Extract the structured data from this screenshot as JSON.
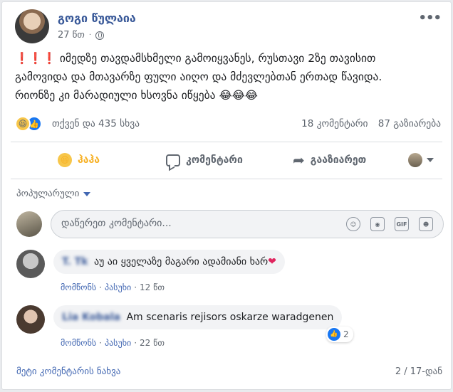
{
  "post": {
    "author": "გოგი წულაია",
    "time": "27 წთ",
    "exclamations": "❗❗❗",
    "text_line1": "იმედზე თავდამსხმელი გამოიყვანეს, რუსთავი 2ზე თავისით",
    "text_line2": "გამოვიდა და მთავარზე ფული აიღო და მძევლებთან ერთად წავიდა.",
    "text_line3": "რიონზე კი მარადიული ხსოვნა იწყება",
    "emojis": "😂😂😂"
  },
  "summary": {
    "reactions_text": "თქვენ და 435 სხვა",
    "comments_text": "18 კომენტარი",
    "shares_text": "87 გაზიარება"
  },
  "actions": {
    "haha_label": "ჰაჰა",
    "comment_label": "კომენტარი",
    "share_label": "გააზიარეთ"
  },
  "comments_section": {
    "filter_label": "პოპულარული",
    "write_placeholder": "დაწერეთ კომენტარი...",
    "gif_label": "GIF"
  },
  "comments": [
    {
      "name": "T. Tk",
      "text": "აუ აი ყველაზე მაგარი ადამიანი ხარ",
      "heart": "❤",
      "like_label": "მომწონს",
      "reply_label": "პასუხი",
      "time": "12 წთ"
    },
    {
      "name": "Lia Kobala",
      "text": "Am scenaris rejisors oskarze waradgenen",
      "like_count": "2",
      "like_label": "მომწონს",
      "reply_label": "პასუხი",
      "time": "22 წთ"
    }
  ],
  "footer": {
    "more_comments": "მეტი კომენტარის ნახვა",
    "pager": "2 / 17-დან"
  },
  "colors": {
    "link_blue": "#385898",
    "fb_blue": "#1877f2",
    "haha_yellow": "#f7b125"
  }
}
